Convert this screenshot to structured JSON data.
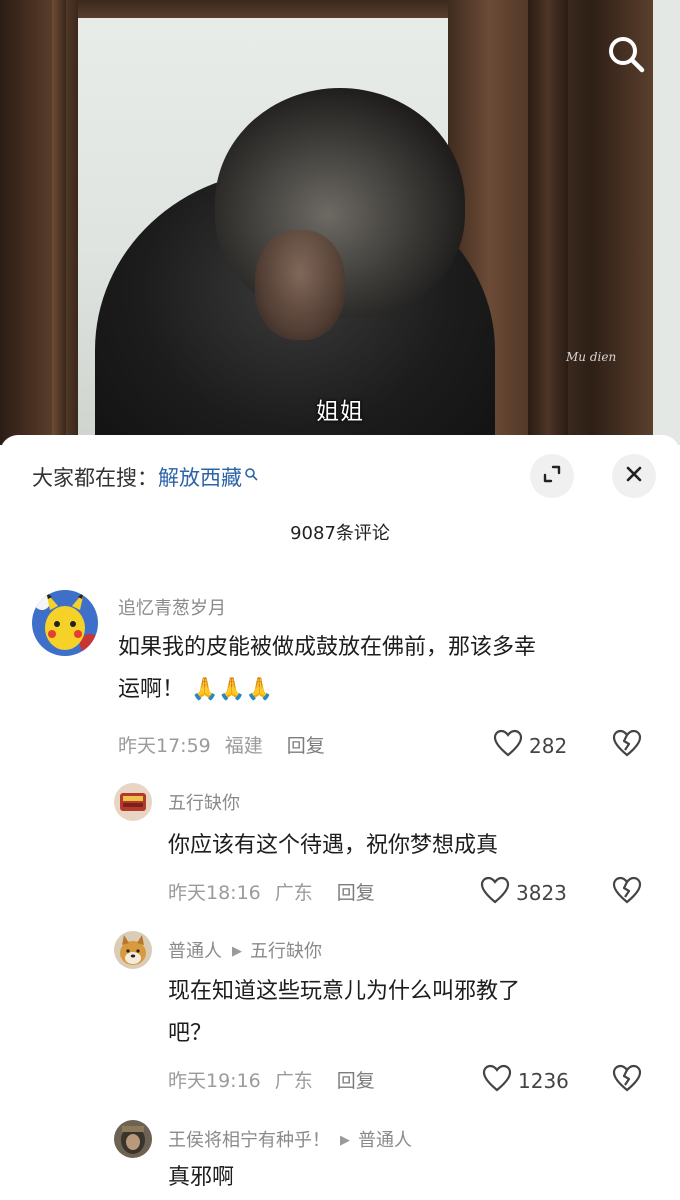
{
  "video": {
    "subtitle": "姐姐",
    "watermark": "Mu dien",
    "search_icon": "search-icon"
  },
  "sheet": {
    "hot_search_prefix": "大家都在搜：",
    "hot_search_keyword": "解放西藏",
    "comment_count": "9087条评论",
    "expand_icon": "expand-icon",
    "close_icon": "close-icon"
  },
  "comments": [
    {
      "username": "追忆青葱岁月",
      "text_line1": "如果我的皮能被做成鼓放在佛前，那该多幸",
      "text_line2": "运啊！",
      "emoji": "🙏🙏🙏",
      "time": "昨天17:59",
      "location": "福建",
      "reply_label": "回复",
      "likes": "282"
    },
    {
      "username": "五行缺你",
      "text": "你应该有这个待遇，祝你梦想成真",
      "time": "昨天18:16",
      "location": "广东",
      "reply_label": "回复",
      "likes": "3823"
    },
    {
      "username": "普通人",
      "reply_to": "五行缺你",
      "text_line1": "现在知道这些玩意儿为什么叫邪教了",
      "text_line2": "吧？",
      "time": "昨天19:16",
      "location": "广东",
      "reply_label": "回复",
      "likes": "1236"
    },
    {
      "username": "王侯将相宁有种乎！",
      "reply_to": "普通人",
      "text": "真邪啊"
    }
  ],
  "colors": {
    "keyword_blue": "#2c64a8",
    "meta_gray": "#9b9b9b",
    "sheet_bg": "#ffffff"
  }
}
